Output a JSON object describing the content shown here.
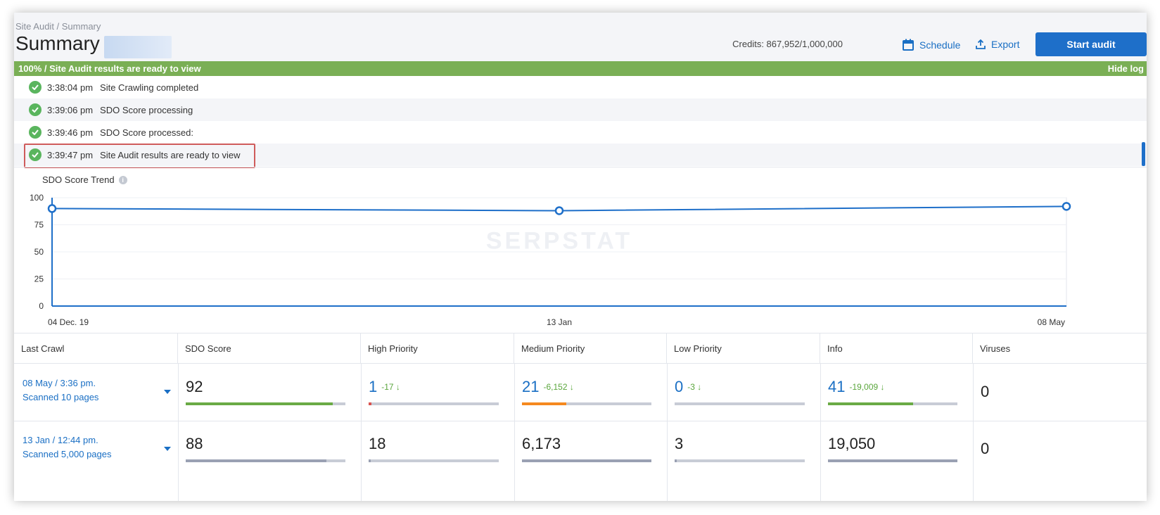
{
  "header": {
    "breadcrumb": "Site Audit / Summary",
    "title": "Summary",
    "credits": "Credits: 867,952/1,000,000",
    "schedule_label": "Schedule",
    "export_label": "Export",
    "start_audit_label": "Start audit"
  },
  "progress": {
    "text": "100% / Site Audit results are ready to view",
    "hide_log_label": "Hide log",
    "value_percent": 100
  },
  "log": [
    {
      "time": "3:38:04 pm",
      "message": "Site Crawling completed"
    },
    {
      "time": "3:39:06 pm",
      "message": "SDO Score processing"
    },
    {
      "time": "3:39:46 pm",
      "message": "SDO Score processed:"
    },
    {
      "time": "3:39:47 pm",
      "message": "Site Audit results are ready to view"
    }
  ],
  "chart_data": {
    "type": "line",
    "title": "SDO Score Trend",
    "x": [
      "04 Dec. 19",
      "13 Jan",
      "08 May"
    ],
    "series": [
      {
        "values": [
          90,
          88,
          92
        ]
      }
    ],
    "ylim": [
      0,
      100
    ],
    "yticks": [
      0,
      25,
      50,
      75,
      100
    ],
    "grid": true,
    "watermark": "SERPSTAT"
  },
  "table": {
    "headers": [
      "Last Crawl",
      "SDO Score",
      "High Priority",
      "Medium Priority",
      "Low Priority",
      "Info",
      "Viruses"
    ],
    "rows": [
      {
        "crawl_date": "08 May / 3:36 pm.",
        "crawl_pages": "Scanned 10 pages",
        "sdo": "92",
        "sdo_fill": 0.92,
        "high": "1",
        "high_delta": "-17",
        "high_fill": 0.02,
        "medium": "21",
        "medium_delta": "-6,152",
        "medium_fill": 0.34,
        "low": "0",
        "low_delta": "-3",
        "low_fill": 0.0,
        "info": "41",
        "info_delta": "-19,009",
        "info_fill": 0.66,
        "viruses": "0"
      },
      {
        "crawl_date": "13 Jan / 12:44 pm.",
        "crawl_pages": "Scanned 5,000 pages",
        "sdo": "88",
        "sdo_fill": 0.88,
        "high": "18",
        "high_fill": 0.01,
        "medium": "6,173",
        "medium_fill": 1.0,
        "low": "3",
        "low_fill": 0.01,
        "info": "19,050",
        "info_fill": 1.0,
        "viruses": "0"
      }
    ]
  },
  "colors": {
    "accent": "#1e6fc9",
    "progress_green": "#7aaf55",
    "check_green": "#5ab55e",
    "highlight_red": "#cf5b5b",
    "bar_green": "#6aaa45",
    "bar_orange": "#f5891f",
    "bar_red": "#d9534f",
    "bar_gray": "#9aa1b3"
  }
}
